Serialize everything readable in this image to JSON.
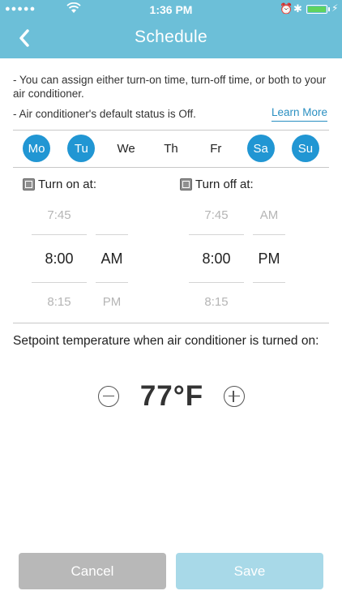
{
  "status_bar": {
    "signal": "●●●●●",
    "time": "1:36 PM"
  },
  "header": {
    "title": "Schedule"
  },
  "info": {
    "line1": "- You can assign either turn-on time, turn-off time, or both to your air conditioner.",
    "line2": "- Air conditioner's default status is Off.",
    "learn_more": "Learn More"
  },
  "days": [
    {
      "label": "Mo",
      "selected": true
    },
    {
      "label": "Tu",
      "selected": true
    },
    {
      "label": "We",
      "selected": false
    },
    {
      "label": "Th",
      "selected": false
    },
    {
      "label": "Fr",
      "selected": false
    },
    {
      "label": "Sa",
      "selected": true
    },
    {
      "label": "Su",
      "selected": true
    }
  ],
  "turn_on": {
    "label": "Turn on at:",
    "time_prev": "7:45",
    "time": "8:00",
    "time_next": "8:15",
    "ampm_prev": "",
    "ampm": "AM",
    "ampm_next": "PM"
  },
  "turn_off": {
    "label": "Turn off at:",
    "time_prev": "7:45",
    "time": "8:00",
    "time_next": "8:15",
    "ampm_prev": "AM",
    "ampm": "PM",
    "ampm_next": ""
  },
  "setpoint": {
    "label": "Setpoint temperature when air conditioner is turned on:",
    "value": "77°F"
  },
  "buttons": {
    "cancel": "Cancel",
    "save": "Save"
  },
  "colors": {
    "header": "#6cbfd8",
    "day_selected": "#2196d3",
    "link": "#2a8fc1",
    "cancel_button": "#b8b8b8",
    "save_button": "#a8d9e8"
  }
}
